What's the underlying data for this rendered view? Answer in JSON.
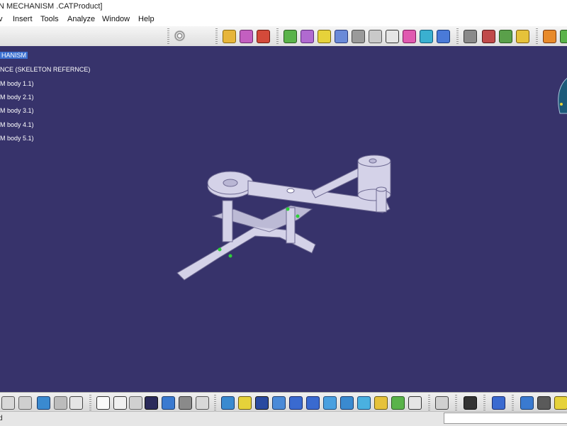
{
  "window": {
    "title": "N MECHANISM .CATProduct]"
  },
  "menu": {
    "items": [
      {
        "label": "v"
      },
      {
        "label": "Insert"
      },
      {
        "label": "Tools"
      },
      {
        "label": "Analyze"
      },
      {
        "label": "Window"
      },
      {
        "label": "Help"
      }
    ]
  },
  "tree": {
    "items": [
      {
        "label": "HANISM"
      },
      {
        "label": "NCE (SKELETON REFERNCE)"
      },
      {
        "label": "M body 1.1)"
      },
      {
        "label": "M body 2.1)"
      },
      {
        "label": "M body 3.1)"
      },
      {
        "label": "M body 4.1)"
      },
      {
        "label": "M body 5.1)"
      }
    ]
  },
  "status": {
    "text": "d",
    "command_placeholder": ""
  },
  "colors": {
    "viewport": "#37336b",
    "selection": "#3a6fd0",
    "part": "#d4d2e8"
  }
}
